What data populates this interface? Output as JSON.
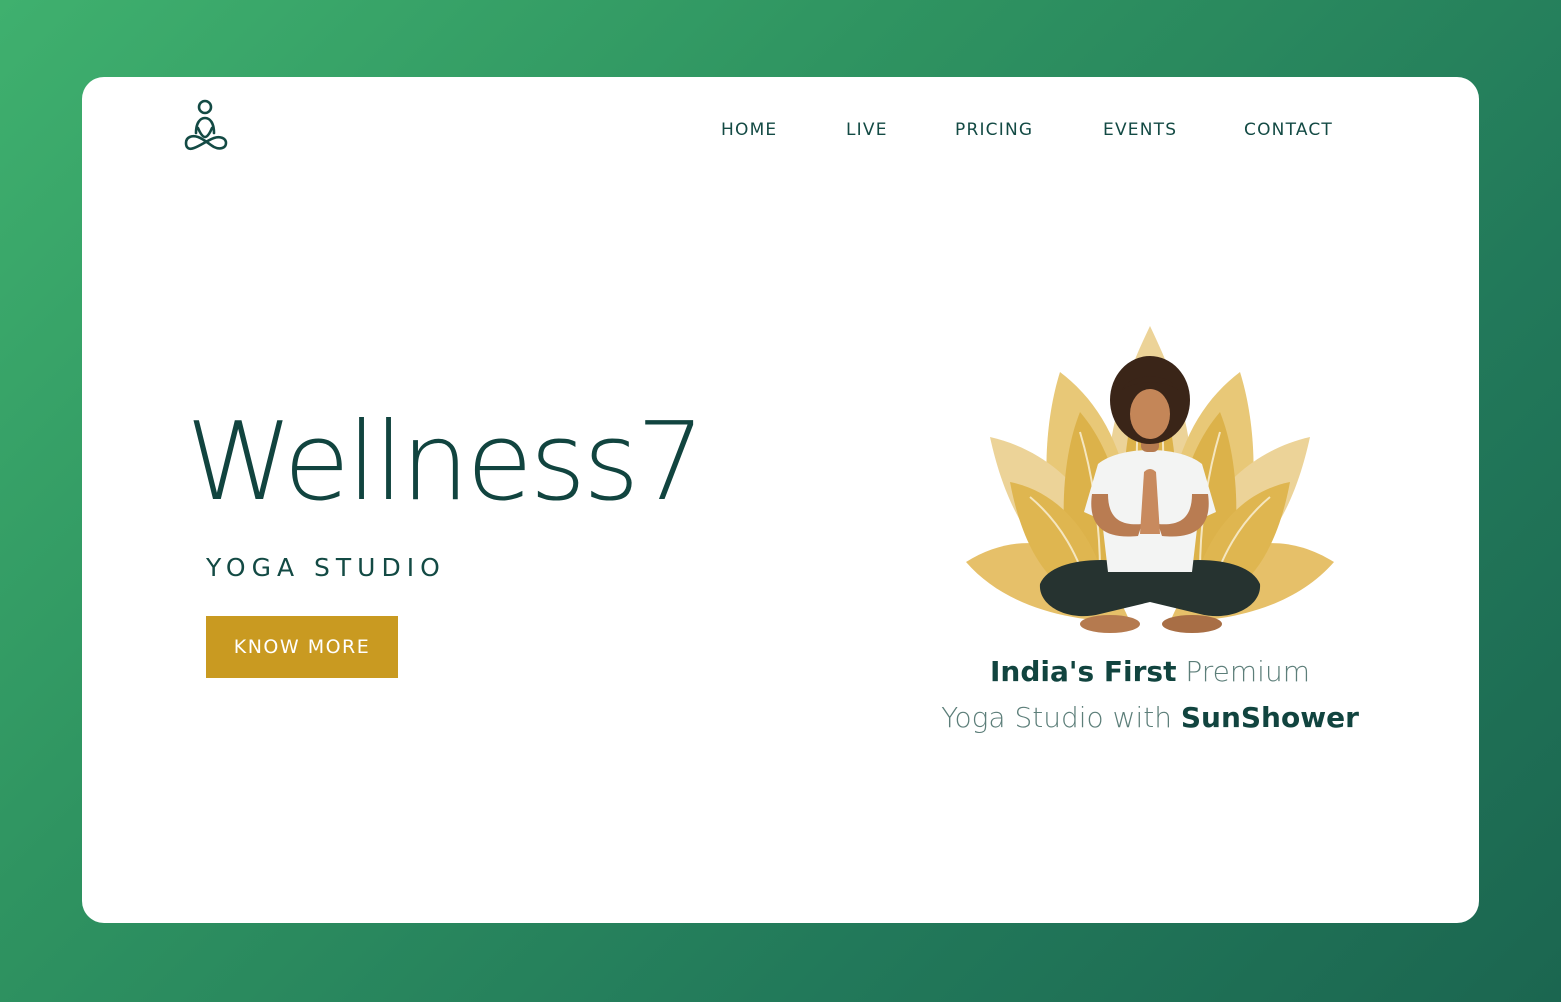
{
  "nav": {
    "items": [
      {
        "label": "HOME"
      },
      {
        "label": "LIVE"
      },
      {
        "label": "PRICING"
      },
      {
        "label": "EVENTS"
      },
      {
        "label": "CONTACT"
      }
    ]
  },
  "hero": {
    "title": "Wellness7",
    "subtitle": "YOGA STUDIO",
    "cta_label": "KNOW MORE"
  },
  "tagline": {
    "line1_bold": "India's First",
    "line1_light": "Premium",
    "line2_light": "Yoga Studio with",
    "line2_bold": "SunShower"
  },
  "icons": {
    "logo": "meditating-person-icon"
  },
  "colors": {
    "background_start": "#3fb06e",
    "background_end": "#1b6650",
    "primary_text": "#11443f",
    "accent_gold": "#c99a21",
    "lotus_gold": "#dcb24a",
    "card": "#ffffff"
  }
}
